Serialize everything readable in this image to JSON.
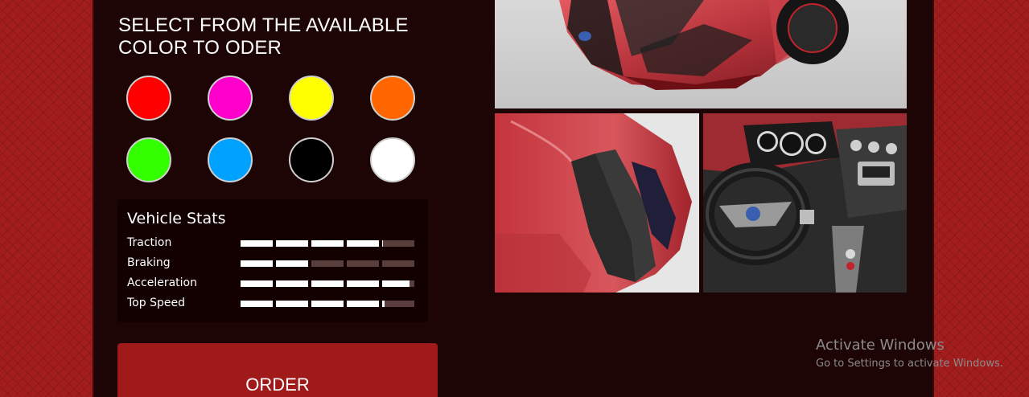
{
  "heading": "SELECT FROM THE AVAILABLE COLOR TO ODER",
  "colors": [
    {
      "name": "red",
      "hex": "#ff0000"
    },
    {
      "name": "magenta",
      "hex": "#ff00cc"
    },
    {
      "name": "yellow",
      "hex": "#ffff00"
    },
    {
      "name": "orange",
      "hex": "#ff6600"
    },
    {
      "name": "green",
      "hex": "#33ff00"
    },
    {
      "name": "blue",
      "hex": "#00a2ff"
    },
    {
      "name": "black",
      "hex": "#000000"
    },
    {
      "name": "white",
      "hex": "#ffffff"
    }
  ],
  "stats": {
    "title": "Vehicle Stats",
    "items": [
      {
        "label": "Traction",
        "value": 0.82
      },
      {
        "label": "Braking",
        "value": 0.39
      },
      {
        "label": "Acceleration",
        "value": 0.97
      },
      {
        "label": "Top Speed",
        "value": 0.83
      }
    ]
  },
  "order_button": "ORDER",
  "gallery": [
    {
      "name": "car-front-photo",
      "icon": "car-front-image"
    },
    {
      "name": "car-side-photo",
      "icon": "car-side-image"
    },
    {
      "name": "car-interior-photo",
      "icon": "car-interior-image"
    }
  ],
  "watermark": {
    "title": "Activate Windows",
    "subtitle": "Go to Settings to activate Windows."
  },
  "theme": {
    "background": "#a31d1d",
    "panel": "#1d0505",
    "card": "#130101",
    "accent": "#a11a1a"
  }
}
